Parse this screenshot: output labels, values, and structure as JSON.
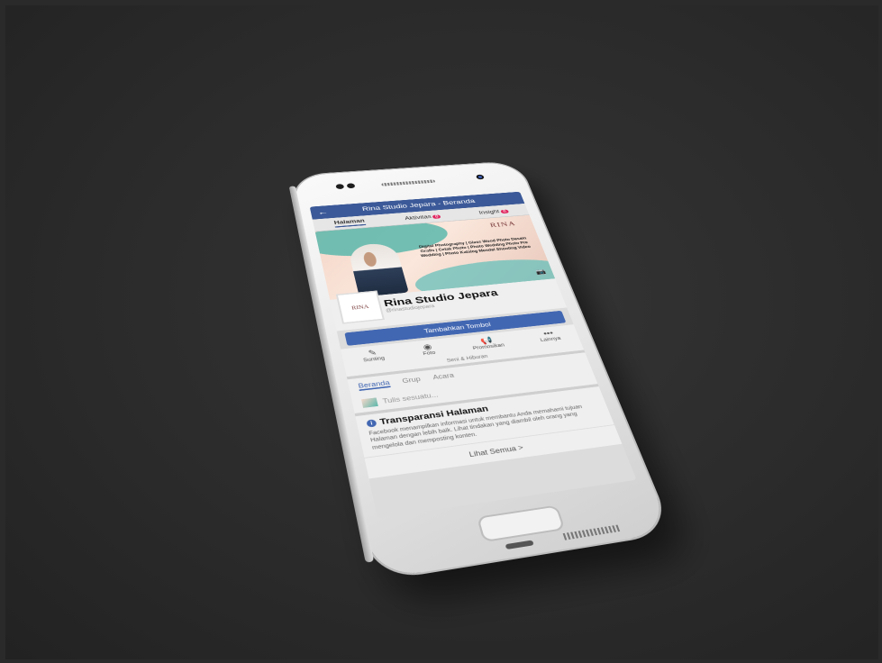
{
  "topbar": {
    "title": "Rina Studio Jepara - Beranda",
    "back_icon": "arrow-left-icon"
  },
  "tabs": [
    {
      "label": "Halaman",
      "badge": ""
    },
    {
      "label": "Aktivitas",
      "badge": "8"
    },
    {
      "label": "Insight",
      "badge": "6"
    }
  ],
  "cover": {
    "logo": "RINA",
    "services": "Digital Photography | Glass Wood Photo Desain Grafis | Cetak Photo | Photo Wedding Photo Pre Wedding | Photo Katalog Mendel Shooting Video",
    "camera_icon": "camera-icon"
  },
  "profile": {
    "avatar_text": "RINA",
    "name": "Rina Studio Jepara",
    "handle": "@rinastudiojepara"
  },
  "add_button": "Tambahkan Tombol",
  "actions": [
    {
      "label": "Sunting",
      "icon": "edit-icon"
    },
    {
      "label": "Foto",
      "icon": "camera-icon"
    },
    {
      "label": "Promosikan",
      "icon": "megaphone-icon"
    },
    {
      "label": "Lainnya",
      "icon": "more-icon"
    }
  ],
  "category": "Seni & Hiburan",
  "subtabs": [
    "Beranda",
    "Grup",
    "Acara"
  ],
  "compose_placeholder": "Tulis sesuatu...",
  "transparency": {
    "title": "Transparansi Halaman",
    "description": "Facebook menampilkan informasi untuk membantu Anda memahami tujuan Halaman dengan lebih baik. Lihat tindakan yang diambil oleh orang yang mengelola dan memposting konten.",
    "see_all": "Lihat Semua"
  },
  "colors": {
    "facebook_blue": "#3b5998",
    "button_blue": "#4267b2",
    "badge_red": "#e0245e"
  }
}
